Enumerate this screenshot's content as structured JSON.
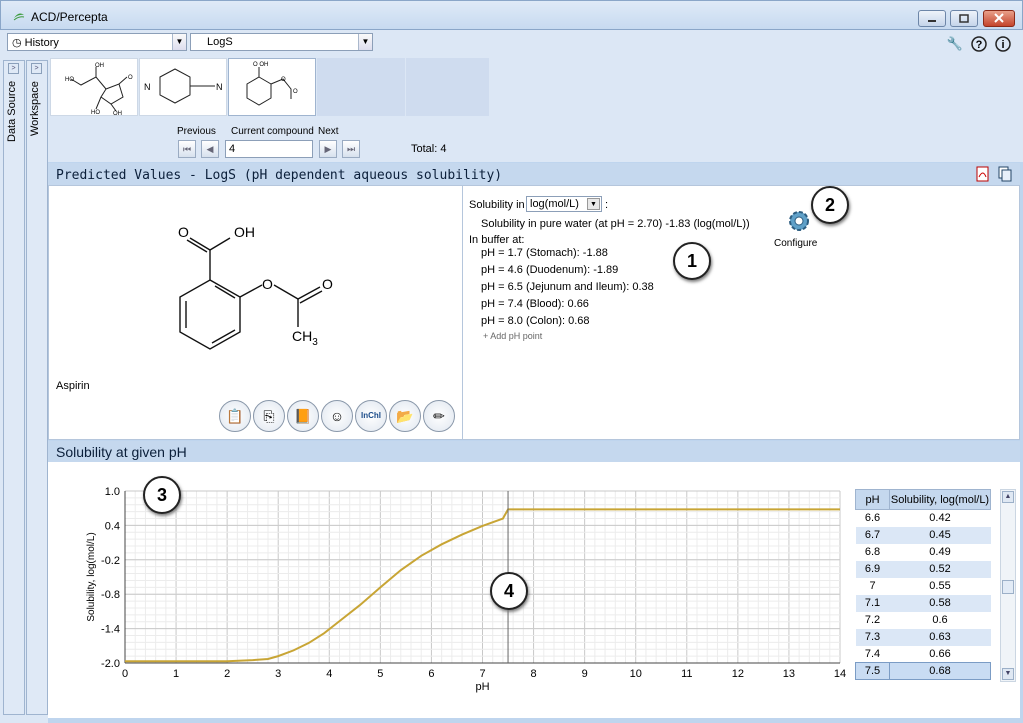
{
  "window": {
    "title": "ACD/Percepta"
  },
  "toolbar": {
    "history_label": "History",
    "property_label": "LogS"
  },
  "side_tabs": [
    "Data Source",
    "Workspace"
  ],
  "nav": {
    "previous_label": "Previous",
    "current_label": "Current compound",
    "next_label": "Next",
    "current_value": "4",
    "total": "Total: 4"
  },
  "predicted": {
    "title": "Predicted Values - LogS (pH dependent aqueous solubility)",
    "compound_name": "Aspirin",
    "solubility_in_label": "Solubility in",
    "colon": ":",
    "unit_value": "log(mol/L)",
    "pure_water": "Solubility in pure water (at pH = 2.70) -1.83 (log(mol/L))",
    "buffer_label": "In buffer at:",
    "buffer_rows": [
      "pH = 1.7 (Stomach): -1.88",
      "pH = 4.6 (Duodenum): -1.89",
      "pH = 6.5 (Jejunum and Ileum): 0.38",
      "pH = 7.4 (Blood): 0.66",
      "pH = 8.0 (Colon): 0.68"
    ],
    "add_ph_label": "+ Add pH point",
    "configure_label": "Configure",
    "structure_labels": {
      "o_oh": "O",
      "oh": "OH",
      "o_ester": "O",
      "o_keto": "O",
      "ch3": "CH",
      "ch3_sub": "3"
    }
  },
  "markers": [
    "1",
    "2",
    "3",
    "4"
  ],
  "graph_section": {
    "title": "Solubility at given pH"
  },
  "chart_data": {
    "type": "line",
    "xlabel": "pH",
    "ylabel": "Solubility, log(mol/L)",
    "xlim": [
      0,
      14
    ],
    "ylim": [
      -2.0,
      1.0
    ],
    "x_ticks": [
      "0",
      "1",
      "2",
      "3",
      "4",
      "5",
      "6",
      "7",
      "8",
      "9",
      "10",
      "11",
      "12",
      "13",
      "14"
    ],
    "y_ticks": [
      "1.0",
      "0.4",
      "-0.2",
      "-0.8",
      "-1.4",
      "-2.0"
    ],
    "grid": true,
    "marker_line_x": 7.5,
    "color": "#c8a535",
    "x": [
      0,
      1,
      2,
      2.5,
      2.8,
      3.0,
      3.3,
      3.6,
      3.9,
      4.2,
      4.6,
      5.0,
      5.4,
      5.8,
      6.2,
      6.6,
      7.0,
      7.4,
      7.5,
      8,
      9,
      10,
      11,
      12,
      13,
      14
    ],
    "y": [
      -1.97,
      -1.97,
      -1.97,
      -1.95,
      -1.93,
      -1.88,
      -1.78,
      -1.65,
      -1.48,
      -1.27,
      -0.99,
      -0.68,
      -0.38,
      -0.13,
      0.07,
      0.24,
      0.39,
      0.52,
      0.68,
      0.68,
      0.68,
      0.68,
      0.68,
      0.68,
      0.68,
      0.68
    ]
  },
  "table": {
    "headers": [
      "pH",
      "Solubility, log(mol/L)"
    ],
    "rows": [
      [
        "6.6",
        "0.42"
      ],
      [
        "6.7",
        "0.45"
      ],
      [
        "6.8",
        "0.49"
      ],
      [
        "6.9",
        "0.52"
      ],
      [
        "7",
        "0.55"
      ],
      [
        "7.1",
        "0.58"
      ],
      [
        "7.2",
        "0.6"
      ],
      [
        "7.3",
        "0.63"
      ],
      [
        "7.4",
        "0.66"
      ],
      [
        "7.5",
        "0.68"
      ]
    ]
  },
  "icons": {
    "wrench": "wrench-icon",
    "help": "help-icon",
    "info": "info-icon",
    "pdf": "pdf-icon",
    "copy": "copy-icon"
  }
}
